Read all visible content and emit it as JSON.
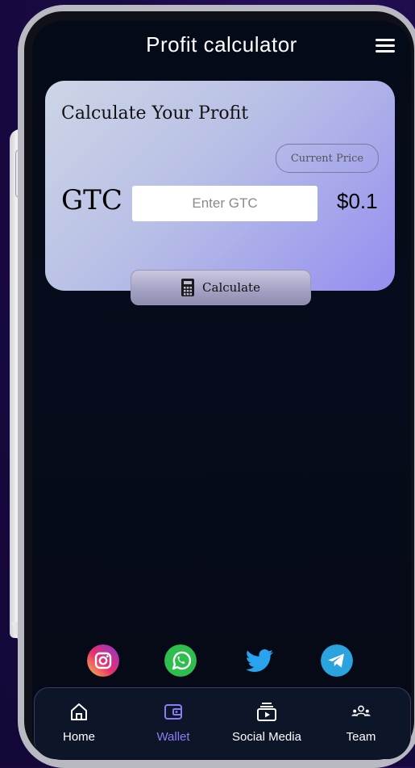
{
  "header": {
    "title": "Profit calculator"
  },
  "calculator": {
    "heading": "Calculate Your Profit",
    "current_price_label": "Current Price",
    "coin_label": "GTC",
    "input_placeholder": "Enter GTC",
    "price_value": "$0.1",
    "calculate_label": "Calculate"
  },
  "social": [
    {
      "name": "instagram-icon"
    },
    {
      "name": "whatsapp-icon"
    },
    {
      "name": "twitter-icon"
    },
    {
      "name": "telegram-icon"
    }
  ],
  "nav": {
    "items": [
      {
        "label": "Home",
        "icon": "home-icon"
      },
      {
        "label": "Wallet",
        "icon": "wallet-icon",
        "active": true
      },
      {
        "label": "Social Media",
        "icon": "social-media-icon"
      },
      {
        "label": "Team",
        "icon": "team-icon"
      }
    ]
  },
  "colors": {
    "accent": "#8d7df4",
    "background": "#050a18",
    "nav_active": "#8d7df4"
  }
}
